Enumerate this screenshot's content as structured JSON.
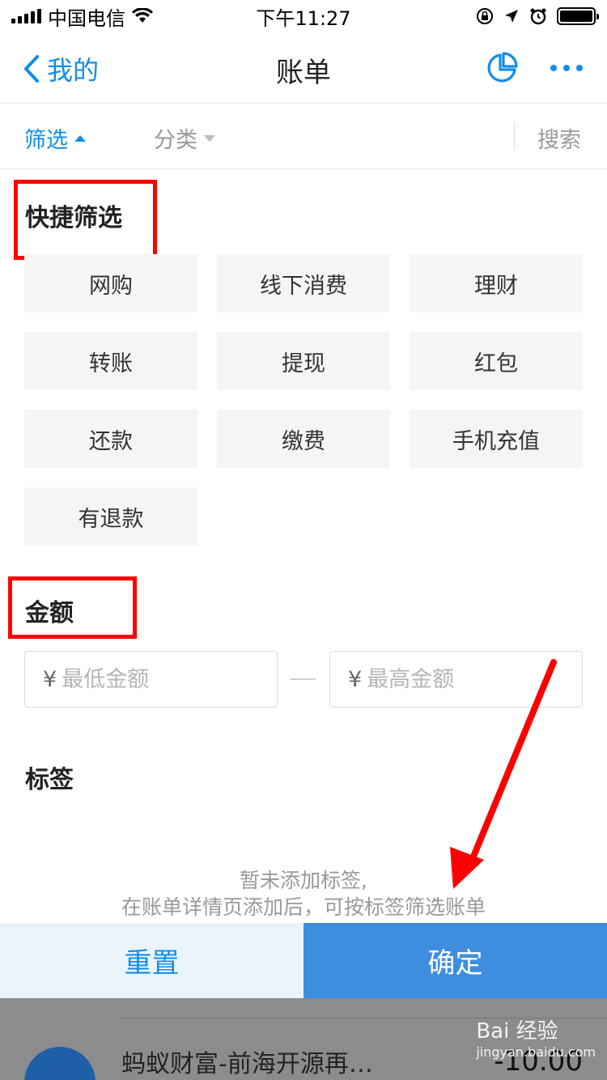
{
  "status_bar": {
    "carrier": "中国电信",
    "time": "下午11:27"
  },
  "nav": {
    "back_label": "我的",
    "title": "账单"
  },
  "filter_bar": {
    "filter": "筛选",
    "category": "分类",
    "search": "搜索"
  },
  "quick_filter": {
    "title": "快捷筛选",
    "items": [
      "网购",
      "线下消费",
      "理财",
      "转账",
      "提现",
      "红包",
      "还款",
      "缴费",
      "手机充值",
      "有退款"
    ]
  },
  "amount": {
    "title": "金额",
    "currency": "¥",
    "min_placeholder": "最低金额",
    "max_placeholder": "最高金额"
  },
  "tags": {
    "title": "标签",
    "hint_line1": "暂未添加标签,",
    "hint_line2": "在账单详情页添加后，可按标签筛选账单"
  },
  "actions": {
    "reset": "重置",
    "confirm": "确定"
  },
  "background_list": {
    "item_title": "蚂蚁财富-前海开源再…",
    "item_amount": "-10.00"
  },
  "watermark": {
    "brand": "Bai 经验",
    "url": "jingyan.baidu.com"
  },
  "colors": {
    "accent": "#108ee9",
    "confirm_bg": "#3e8ee0",
    "annotation_red": "#ff0000"
  }
}
